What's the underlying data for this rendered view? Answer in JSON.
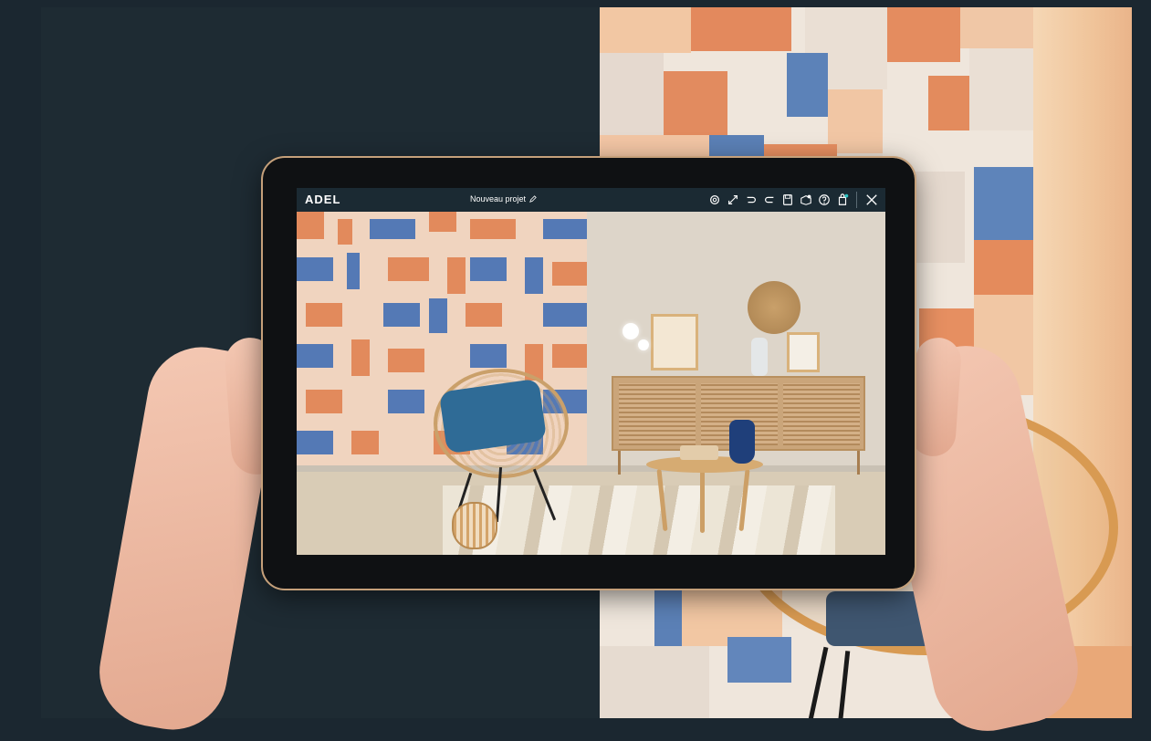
{
  "app": {
    "logo": "ADEL",
    "project_title": "Nouveau projet"
  },
  "toolbar": {
    "icons": [
      "settings-icon",
      "fullscreen-icon",
      "undo-icon",
      "redo-icon",
      "save-icon",
      "catalog-icon",
      "help-icon",
      "cart-icon",
      "close-icon"
    ]
  },
  "colors": {
    "app_bar": "#1b2a33",
    "tile_orange": "#e0885a",
    "tile_blue": "#5479b5",
    "tile_peach": "#f2c7a3",
    "tile_cream": "#eadfd4"
  }
}
